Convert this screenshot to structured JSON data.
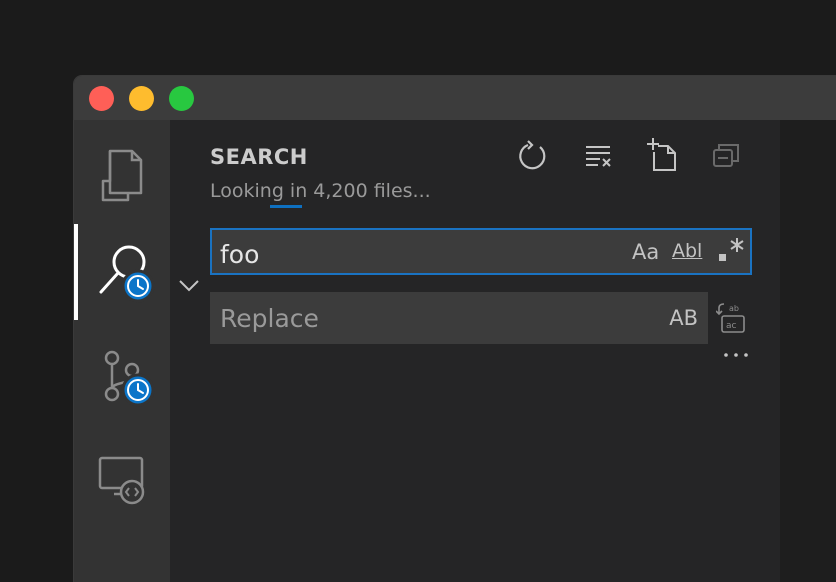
{
  "window": {
    "buttons": {
      "close": "close-button",
      "minimize": "minimize-button",
      "maximize": "maximize-button"
    }
  },
  "activity_bar": {
    "items": [
      {
        "name": "explorer",
        "icon": "files-icon"
      },
      {
        "name": "search",
        "icon": "search-icon",
        "badge_icon": "clock-icon",
        "active": true
      },
      {
        "name": "source-control",
        "icon": "source-control-icon",
        "badge_icon": "clock-icon"
      },
      {
        "name": "remote-explorer",
        "icon": "remote-explorer-icon"
      }
    ]
  },
  "search_view": {
    "title": "SEARCH",
    "status": "Looking in 4,200 files...",
    "actions": [
      "refresh-icon",
      "clear-results-icon",
      "new-search-editor-icon",
      "collapse-all-icon"
    ],
    "search": {
      "value": "foo",
      "options": {
        "match_case": "Aa",
        "whole_word": "Abl",
        "regex": ".*"
      }
    },
    "replace": {
      "placeholder": "Replace",
      "value": "",
      "preserve_case": "AB",
      "replace_all_icon": "replace-all-icon"
    },
    "more_icon": "ellipsis-icon",
    "toggle_icon": "chevron-down-icon"
  },
  "colors": {
    "accent": "#0e70c0",
    "focus_border": "#1a73c2",
    "activity_bar": "#333333",
    "sidebar": "#252526",
    "input": "#3c3c3c",
    "badge": "#0b75c9"
  }
}
